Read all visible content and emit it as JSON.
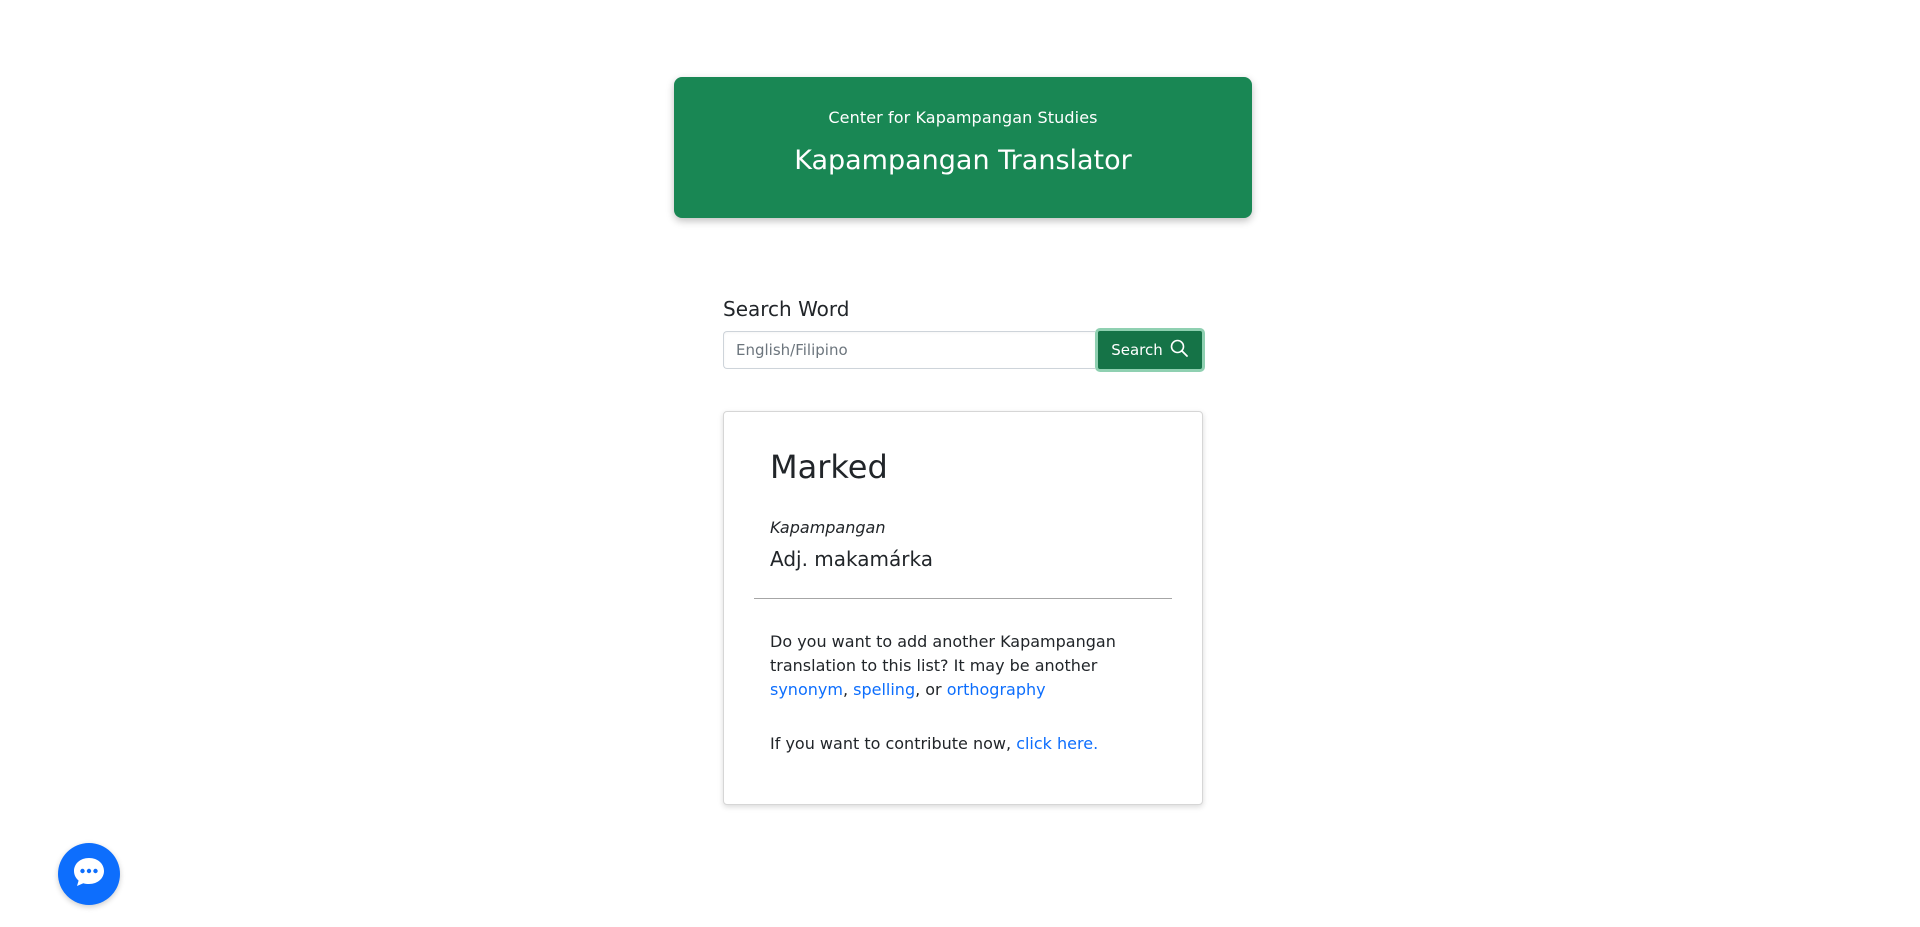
{
  "header": {
    "org": "Center for Kapampangan Studies",
    "title": "Kapampangan Translator",
    "background": "#198754"
  },
  "search": {
    "label": "Search Word",
    "placeholder": "English/Filipino",
    "value": "",
    "button_label": "Search",
    "button_icon": "search-icon"
  },
  "result": {
    "word": "Marked",
    "language": "Kapampangan",
    "translation": "Adj. makamárka",
    "prompt_text": "Do you want to add another Kapampangan translation to this list? It may be another",
    "links": {
      "synonym": "synonym",
      "spelling": "spelling",
      "orthography": "orthography"
    },
    "separator_1": ",",
    "separator_2": ", or",
    "contribute_text": "If you want to contribute now,",
    "contribute_link": "click here."
  },
  "chat": {
    "icon": "chat-bubble-icon",
    "color": "#0d6efd"
  }
}
